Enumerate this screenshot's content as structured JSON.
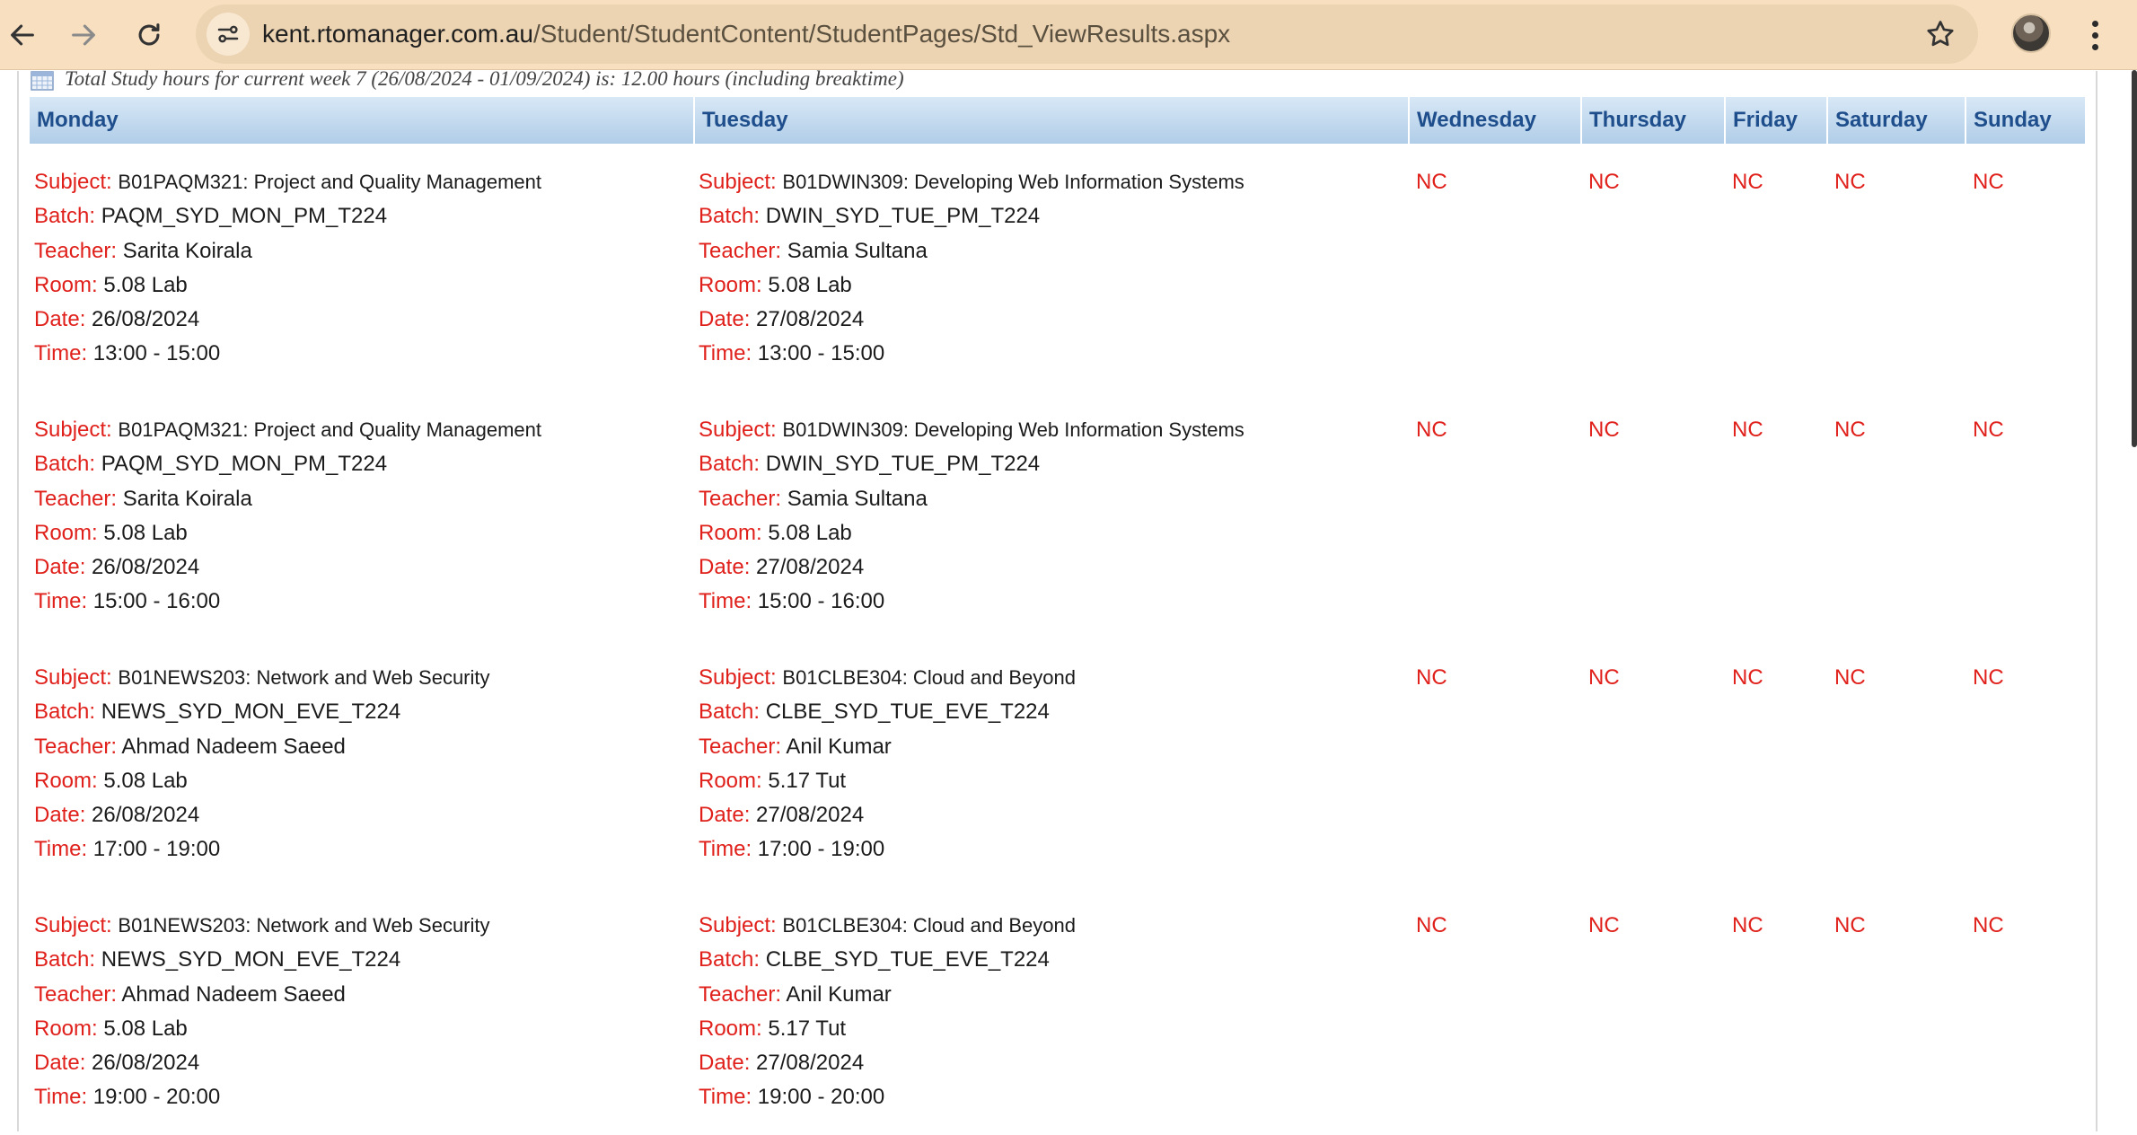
{
  "browser": {
    "url_host": "kent.rtomanager.com.au",
    "url_path": "/Student/StudentContent/StudentPages/Std_ViewResults.aspx",
    "icons": [
      "back-icon",
      "forward-icon",
      "reload-icon",
      "site-info-icon",
      "star-icon",
      "profile-avatar",
      "more-menu-icon"
    ]
  },
  "page": {
    "study_note": "Total Study hours for current week 7 (26/08/2024 - 01/09/2024) is: 12.00 hours (including breaktime)"
  },
  "labels": {
    "subject": "Subject:",
    "batch": "Batch:",
    "teacher": "Teacher:",
    "room": "Room:",
    "date": "Date:",
    "time": "Time:"
  },
  "days": [
    "Monday",
    "Tuesday",
    "Wednesday",
    "Thursday",
    "Friday",
    "Saturday",
    "Sunday"
  ],
  "nc_text": "NC",
  "rows": [
    {
      "monday": {
        "subject": "B01PAQM321: Project and Quality Management",
        "batch": "PAQM_SYD_MON_PM_T224",
        "teacher": "Sarita Koirala",
        "room": "5.08 Lab",
        "date": "26/08/2024",
        "time": "13:00 - 15:00"
      },
      "tuesday": {
        "subject": "B01DWIN309: Developing Web Information Systems",
        "batch": "DWIN_SYD_TUE_PM_T224",
        "teacher": "Samia Sultana",
        "room": "5.08 Lab",
        "date": "27/08/2024",
        "time": "13:00 - 15:00"
      }
    },
    {
      "monday": {
        "subject": "B01PAQM321: Project and Quality Management",
        "batch": "PAQM_SYD_MON_PM_T224",
        "teacher": "Sarita Koirala",
        "room": "5.08 Lab",
        "date": "26/08/2024",
        "time": "15:00 - 16:00"
      },
      "tuesday": {
        "subject": "B01DWIN309: Developing Web Information Systems",
        "batch": "DWIN_SYD_TUE_PM_T224",
        "teacher": "Samia Sultana",
        "room": "5.08 Lab",
        "date": "27/08/2024",
        "time": "15:00 - 16:00"
      }
    },
    {
      "monday": {
        "subject": "B01NEWS203: Network and Web Security",
        "batch": "NEWS_SYD_MON_EVE_T224",
        "teacher": "Ahmad Nadeem Saeed",
        "room": "5.08 Lab",
        "date": "26/08/2024",
        "time": "17:00 - 19:00"
      },
      "tuesday": {
        "subject": "B01CLBE304: Cloud and Beyond",
        "batch": "CLBE_SYD_TUE_EVE_T224",
        "teacher": "Anil Kumar",
        "room": "5.17 Tut",
        "date": "27/08/2024",
        "time": "17:00 - 19:00"
      }
    },
    {
      "monday": {
        "subject": "B01NEWS203: Network and Web Security",
        "batch": "NEWS_SYD_MON_EVE_T224",
        "teacher": "Ahmad Nadeem Saeed",
        "room": "5.08 Lab",
        "date": "26/08/2024",
        "time": "19:00 - 20:00"
      },
      "tuesday": {
        "subject": "B01CLBE304: Cloud and Beyond",
        "batch": "CLBE_SYD_TUE_EVE_T224",
        "teacher": "Anil Kumar",
        "room": "5.17 Tut",
        "date": "27/08/2024",
        "time": "19:00 - 20:00"
      }
    }
  ]
}
